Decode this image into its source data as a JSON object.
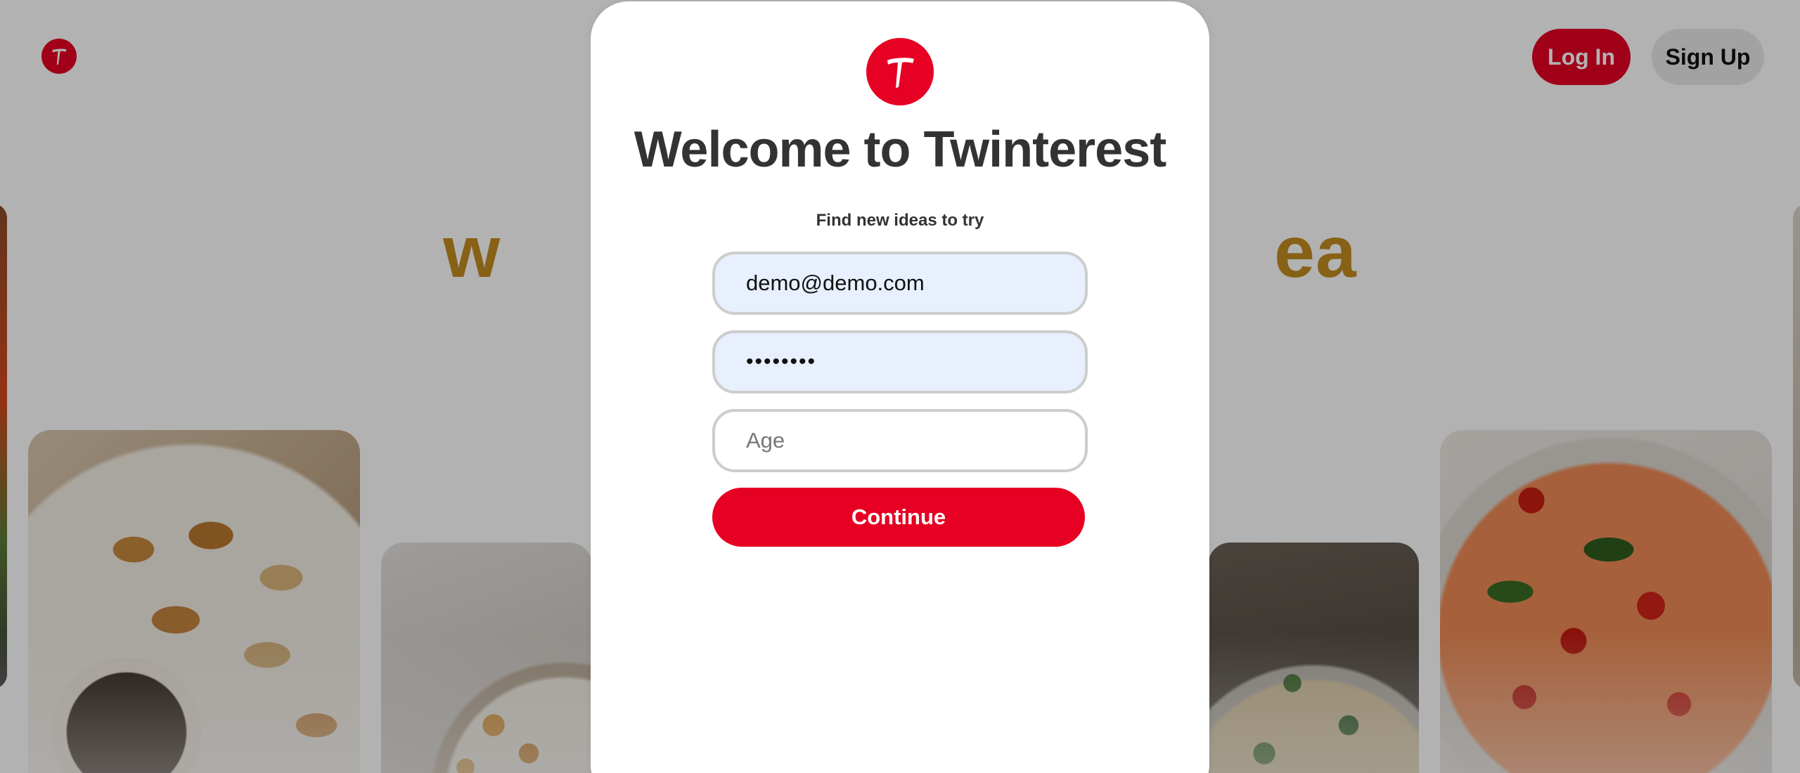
{
  "app": {
    "name": "Twinterest",
    "logo_letter": "T"
  },
  "header": {
    "login_label": "Log In",
    "signup_label": "Sign Up"
  },
  "hero": {
    "visible_left": "w",
    "visible_right": "ea"
  },
  "modal": {
    "title": "Welcome to Twinterest",
    "subtitle": "Find new ideas to try",
    "email_value": "demo@demo.com",
    "password_value": "demopass",
    "age_placeholder": "Age",
    "continue_label": "Continue"
  },
  "colors": {
    "brand_red": "#e60023",
    "hero_gold": "#c28b1f",
    "autofill_blue": "#e8f0fe"
  },
  "icons": {
    "logo": "twinterest-logo-icon"
  }
}
